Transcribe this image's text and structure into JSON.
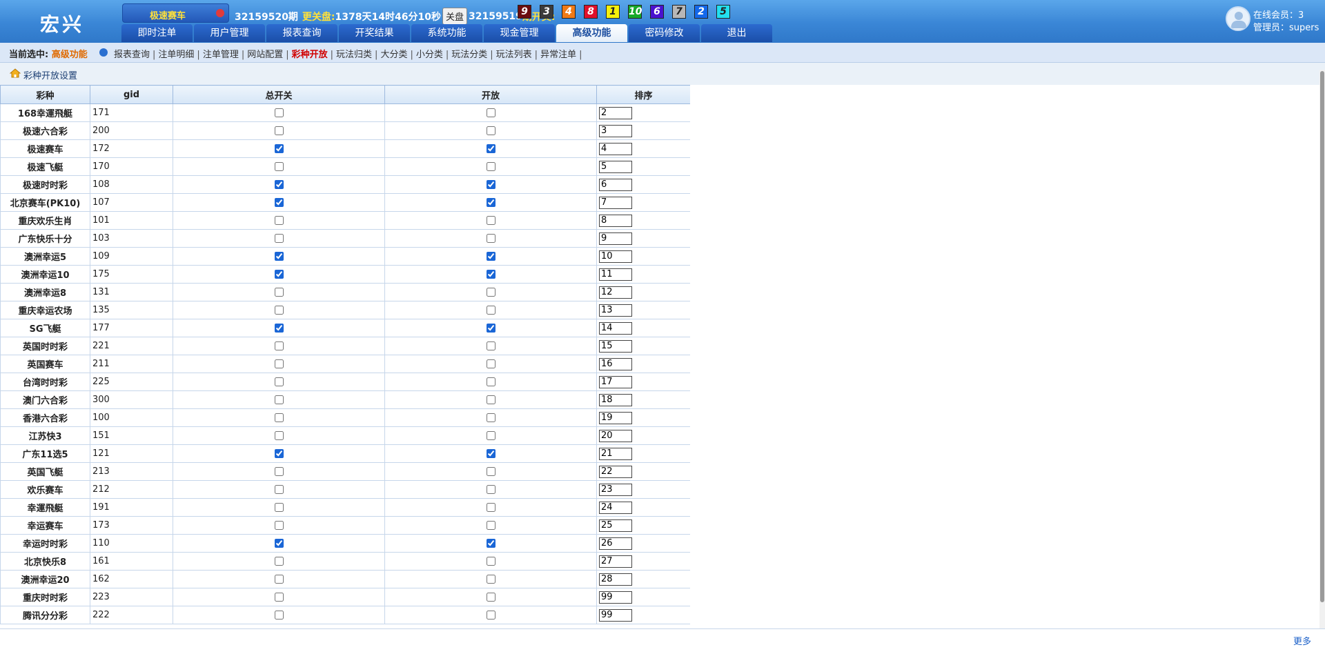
{
  "brand": {
    "logo": "宏兴"
  },
  "header": {
    "lottery_name": "极速赛车",
    "period": "32159520期",
    "close_label": "更关盘:",
    "countdown": "1378天14时46分10秒",
    "close_button": "关盘",
    "prev_period": "32159519",
    "draw_label": "期开奖:",
    "balls": [
      {
        "n": "9",
        "bg": "#6b0d10",
        "fg": "#ffffff"
      },
      {
        "n": "3",
        "bg": "#3b3b3b",
        "fg": "#ffffff"
      },
      {
        "n": "4",
        "bg": "#f07a16",
        "fg": "#ffffff"
      },
      {
        "n": "8",
        "bg": "#e0102b",
        "fg": "#ffffff"
      },
      {
        "n": "1",
        "bg": "#f6f00a",
        "fg": "#222222"
      },
      {
        "n": "10",
        "bg": "#16a82a",
        "fg": "#ffffff"
      },
      {
        "n": "6",
        "bg": "#4a11cf",
        "fg": "#ffffff"
      },
      {
        "n": "7",
        "bg": "#b7b7b7",
        "fg": "#222222"
      },
      {
        "n": "2",
        "bg": "#1468ea",
        "fg": "#ffffff"
      },
      {
        "n": "5",
        "bg": "#22e0f0",
        "fg": "#222222"
      }
    ]
  },
  "nav": {
    "tabs": [
      {
        "label": "即时注单",
        "active": false
      },
      {
        "label": "用户管理",
        "active": false
      },
      {
        "label": "报表查询",
        "active": false
      },
      {
        "label": "开奖结果",
        "active": false
      },
      {
        "label": "系统功能",
        "active": false
      },
      {
        "label": "现金管理",
        "active": false
      },
      {
        "label": "高级功能",
        "active": true
      },
      {
        "label": "密码修改",
        "active": false
      },
      {
        "label": "退出",
        "active": false
      }
    ]
  },
  "user": {
    "online_label": "在线会员：3",
    "admin_label": "管理员：supers"
  },
  "subnav": {
    "current_label": "当前选中:",
    "current_value": "高级功能",
    "links": [
      {
        "label": "报表查询",
        "active": false
      },
      {
        "label": "注单明细",
        "active": false
      },
      {
        "label": "注单管理",
        "active": false
      },
      {
        "label": "网站配置",
        "active": false
      },
      {
        "label": "彩种开放",
        "active": true
      },
      {
        "label": "玩法归类",
        "active": false
      },
      {
        "label": "大分类",
        "active": false
      },
      {
        "label": "小分类",
        "active": false
      },
      {
        "label": "玩法分类",
        "active": false
      },
      {
        "label": "玩法列表",
        "active": false
      },
      {
        "label": "异常注单",
        "active": false
      }
    ]
  },
  "breadcrumb": {
    "title": "彩种开放设置"
  },
  "table": {
    "headers": [
      "彩种",
      "gid",
      "总开关",
      "开放",
      "排序"
    ],
    "rows": [
      {
        "name": "168幸運飛艇",
        "gid": "171",
        "master": false,
        "open": false,
        "order": "2"
      },
      {
        "name": "极速六合彩",
        "gid": "200",
        "master": false,
        "open": false,
        "order": "3"
      },
      {
        "name": "极速赛车",
        "gid": "172",
        "master": true,
        "open": true,
        "order": "4"
      },
      {
        "name": "极速飞艇",
        "gid": "170",
        "master": false,
        "open": false,
        "order": "5"
      },
      {
        "name": "极速时时彩",
        "gid": "108",
        "master": true,
        "open": true,
        "order": "6"
      },
      {
        "name": "北京赛车(PK10)",
        "gid": "107",
        "master": true,
        "open": true,
        "order": "7"
      },
      {
        "name": "重庆欢乐生肖",
        "gid": "101",
        "master": false,
        "open": false,
        "order": "8"
      },
      {
        "name": "广东快乐十分",
        "gid": "103",
        "master": false,
        "open": false,
        "order": "9"
      },
      {
        "name": "澳洲幸运5",
        "gid": "109",
        "master": true,
        "open": true,
        "order": "10"
      },
      {
        "name": "澳洲幸运10",
        "gid": "175",
        "master": true,
        "open": true,
        "order": "11"
      },
      {
        "name": "澳洲幸运8",
        "gid": "131",
        "master": false,
        "open": false,
        "order": "12"
      },
      {
        "name": "重庆幸运农场",
        "gid": "135",
        "master": false,
        "open": false,
        "order": "13"
      },
      {
        "name": "SG飞艇",
        "gid": "177",
        "master": true,
        "open": true,
        "order": "14"
      },
      {
        "name": "英国时时彩",
        "gid": "221",
        "master": false,
        "open": false,
        "order": "15"
      },
      {
        "name": "英国赛车",
        "gid": "211",
        "master": false,
        "open": false,
        "order": "16"
      },
      {
        "name": "台湾时时彩",
        "gid": "225",
        "master": false,
        "open": false,
        "order": "17"
      },
      {
        "name": "澳门六合彩",
        "gid": "300",
        "master": false,
        "open": false,
        "order": "18"
      },
      {
        "name": "香港六合彩",
        "gid": "100",
        "master": false,
        "open": false,
        "order": "19"
      },
      {
        "name": "江苏快3",
        "gid": "151",
        "master": false,
        "open": false,
        "order": "20"
      },
      {
        "name": "广东11选5",
        "gid": "121",
        "master": true,
        "open": true,
        "order": "21"
      },
      {
        "name": "英国飞艇",
        "gid": "213",
        "master": false,
        "open": false,
        "order": "22"
      },
      {
        "name": "欢乐赛车",
        "gid": "212",
        "master": false,
        "open": false,
        "order": "23"
      },
      {
        "name": "幸運飛艇",
        "gid": "191",
        "master": false,
        "open": false,
        "order": "24"
      },
      {
        "name": "幸运赛车",
        "gid": "173",
        "master": false,
        "open": false,
        "order": "25"
      },
      {
        "name": "幸运时时彩",
        "gid": "110",
        "master": true,
        "open": true,
        "order": "26"
      },
      {
        "name": "北京快乐8",
        "gid": "161",
        "master": false,
        "open": false,
        "order": "27"
      },
      {
        "name": "澳洲幸运20",
        "gid": "162",
        "master": false,
        "open": false,
        "order": "28"
      },
      {
        "name": "重庆时时彩",
        "gid": "223",
        "master": false,
        "open": false,
        "order": "99"
      },
      {
        "name": "腾讯分分彩",
        "gid": "222",
        "master": false,
        "open": false,
        "order": "99"
      }
    ]
  },
  "footer": {
    "more": "更多"
  }
}
